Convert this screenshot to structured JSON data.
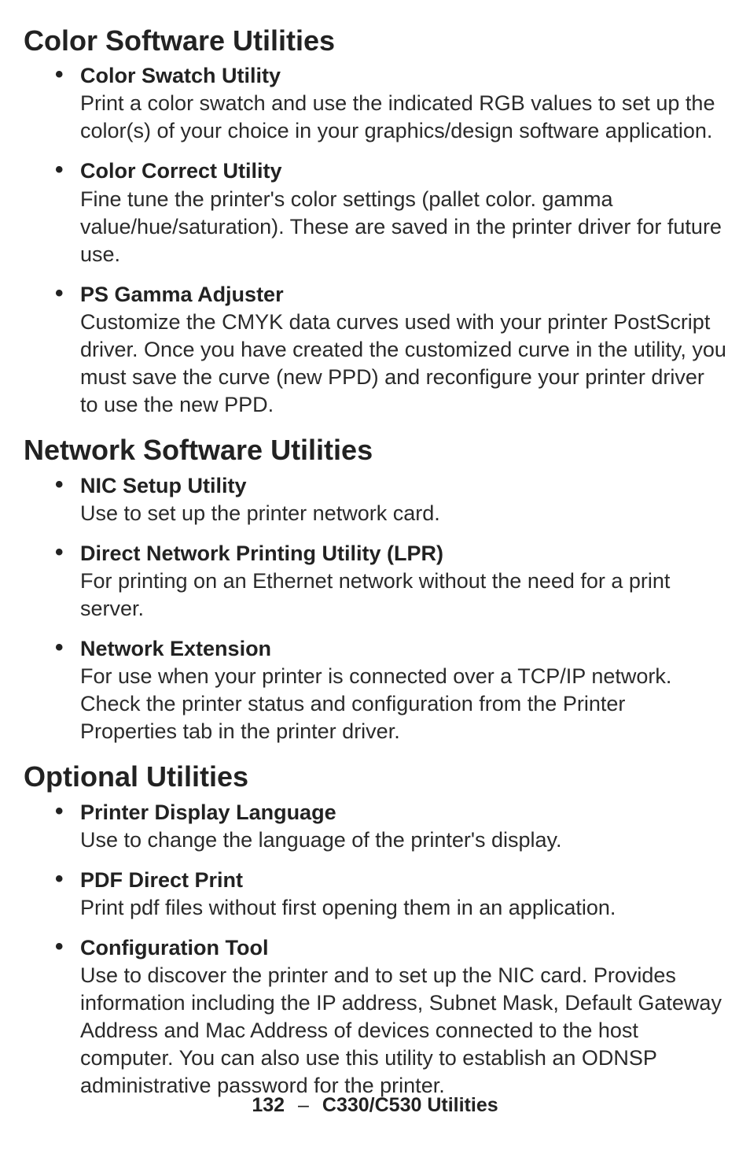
{
  "sections": [
    {
      "heading": "Color Software Utilities",
      "items": [
        {
          "title": "Color Swatch Utility",
          "body": "Print a color swatch and use the indicated RGB values to set up the color(s) of your choice in your graphics/design software application."
        },
        {
          "title": "Color Correct Utility",
          "body": "Fine tune the printer's color settings (pallet color. gamma value/hue/saturation). These are saved in the printer driver for future use."
        },
        {
          "title": "PS Gamma Adjuster",
          "body": "Customize the CMYK data curves used with your printer PostScript driver. Once you have created the customized curve in the utility, you must save the curve (new PPD) and reconfigure your printer driver to use the new PPD."
        }
      ]
    },
    {
      "heading": "Network Software Utilities",
      "items": [
        {
          "title": "NIC Setup Utility",
          "body": "Use to set up the printer network card."
        },
        {
          "title": "Direct Network Printing Utility (LPR)",
          "body": "For printing on an Ethernet network without the need for a print server."
        },
        {
          "title": "Network Extension",
          "body": "For use when your printer is connected over a TCP/IP network. Check the printer status and configuration from the Printer Properties tab in the printer driver."
        }
      ]
    },
    {
      "heading": "Optional Utilities",
      "items": [
        {
          "title": "Printer Display Language",
          "body": "Use to change the language of the printer's display."
        },
        {
          "title": "PDF Direct Print",
          "body": "Print pdf files without first opening them in an application."
        },
        {
          "title": "Configuration Tool",
          "body": "Use to discover the printer and to set up the NIC card. Provides information including the IP address, Subnet Mask, Default Gateway Address and Mac Address of devices connected to the host computer. You can also use this utility to establish an ODNSP administrative password for the printer."
        }
      ]
    }
  ],
  "footer": {
    "page_number": "132",
    "separator": "–",
    "section_label": "C330/C530 Utilities"
  }
}
